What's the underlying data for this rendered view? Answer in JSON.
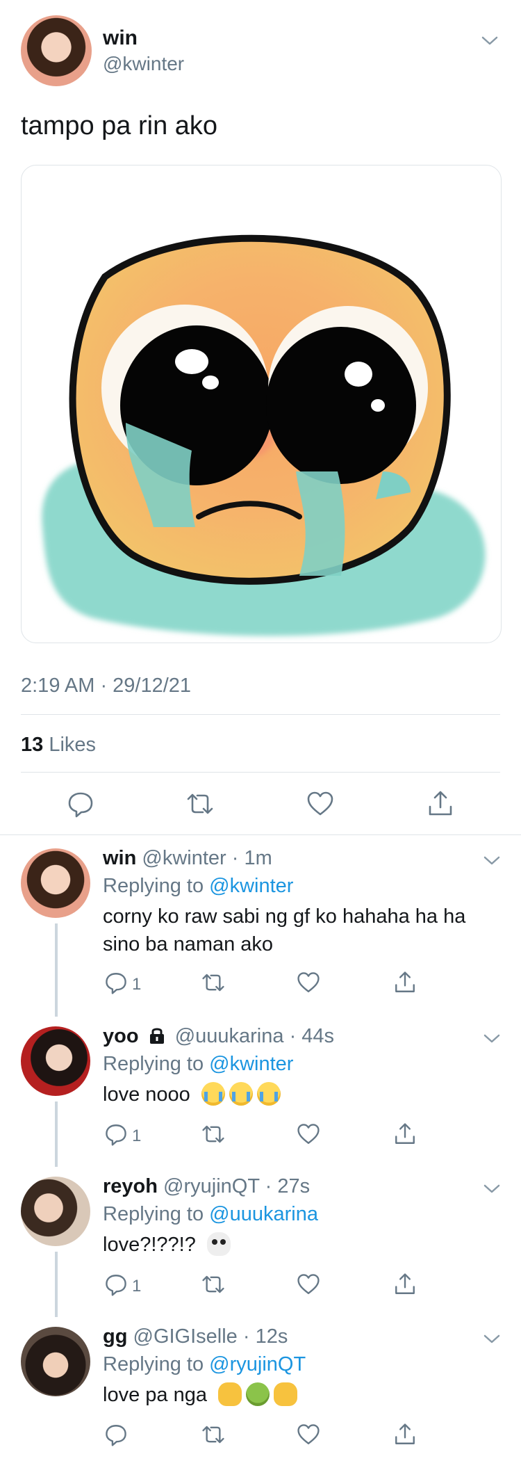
{
  "main_tweet": {
    "name": "win",
    "handle": "@kwinter",
    "text": "tampo pa rin ako",
    "media_icon": "crying-emoji-sticker",
    "timestamp": "2:19 AM · 29/12/21",
    "likes_count": "13",
    "likes_label": "Likes",
    "actions": [
      "reply-icon",
      "retweet-icon",
      "like-icon",
      "share-icon"
    ]
  },
  "replies": [
    {
      "name": "win",
      "handle": "@kwinter",
      "sep": "·",
      "time": "1m",
      "replying_prefix": "Replying to",
      "replying_to": "@kwinter",
      "text": "corny ko raw sabi ng gf ko hahaha ha ha sino ba naman ako",
      "reply_count": "1"
    },
    {
      "name": "yoo",
      "handle": "@uuukarina",
      "sep": "·",
      "time": "44s",
      "replying_prefix": "Replying to",
      "replying_to": "@kwinter",
      "text": "love nooo",
      "emojis": [
        "loudly-crying-face",
        "loudly-crying-face",
        "loudly-crying-face"
      ],
      "reply_count": "1"
    },
    {
      "name": "reyoh",
      "handle": "@ryujinQT",
      "sep": "·",
      "time": "27s",
      "replying_prefix": "Replying to",
      "replying_to": "@uuukarina",
      "text": "love?!??!?",
      "emojis": [
        "skull"
      ],
      "reply_count": "1"
    },
    {
      "name": "gg",
      "handle": "@GIGIselle",
      "sep": "·",
      "time": "12s",
      "replying_prefix": "Replying to",
      "replying_to": "@ryujinQT",
      "text": "love pa nga",
      "emojis": [
        "raised-hand",
        "face-vomiting",
        "raised-back-of-hand"
      ],
      "reply_count": ""
    }
  ],
  "colors": {
    "link": "#1b95e0",
    "secondary_text": "#657786",
    "divider": "#dfe4e8",
    "thread_line": "#ccd6dd"
  }
}
